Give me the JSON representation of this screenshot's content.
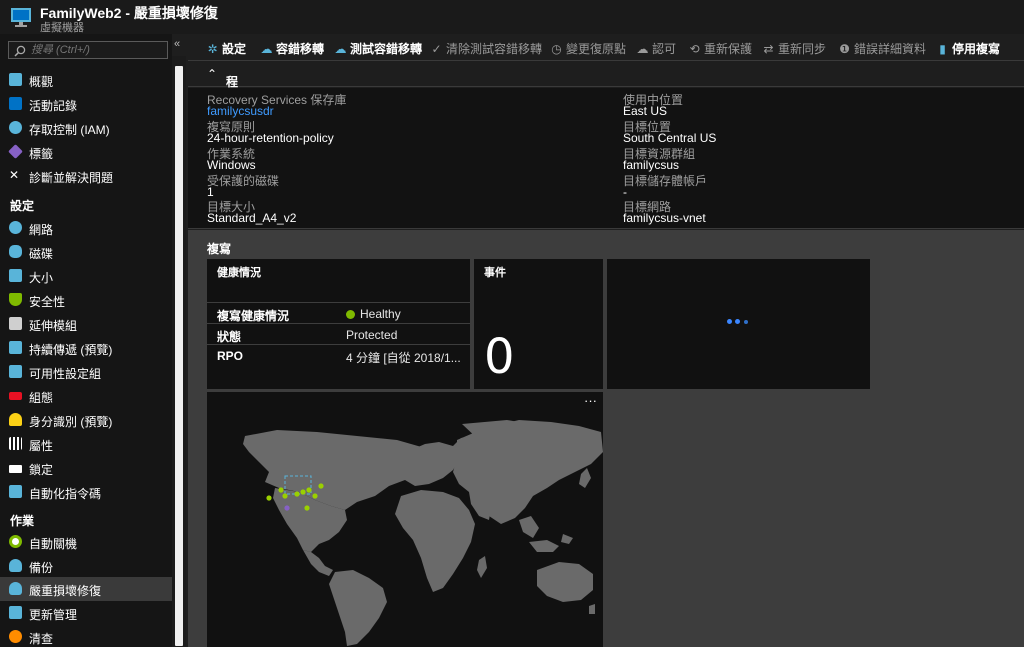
{
  "window": {
    "title": "FamilyWeb2 - 嚴重損壞修復",
    "subtitle": "虛擬機器",
    "collapse_glyph": "«"
  },
  "search": {
    "placeholder": "搜尋 (Ctrl+/)"
  },
  "sidebar": {
    "items": [
      {
        "label": "概觀",
        "icon": "monitor-icon",
        "color": "#59b4d9"
      },
      {
        "label": "活動記錄",
        "icon": "log-icon",
        "color": "#0072c6"
      },
      {
        "label": "存取控制 (IAM)",
        "icon": "users-icon",
        "color": "#59b4d9"
      },
      {
        "label": "標籤",
        "icon": "tag-icon",
        "color": "#8661c5"
      },
      {
        "label": "診斷並解決問題",
        "icon": "wrench-icon",
        "color": "#ffffff"
      }
    ],
    "section_settings": "設定",
    "settings_items": [
      {
        "label": "網路",
        "icon": "network-icon",
        "color": "#59b4d9"
      },
      {
        "label": "磁碟",
        "icon": "disk-icon",
        "color": "#59b4d9"
      },
      {
        "label": "大小",
        "icon": "monitor-icon",
        "color": "#59b4d9"
      },
      {
        "label": "安全性",
        "icon": "shield-icon",
        "color": "#7fba00"
      },
      {
        "label": "延伸模組",
        "icon": "extensions-icon",
        "color": "#ffffff"
      },
      {
        "label": "持續傳遞 (預覽)",
        "icon": "delivery-icon",
        "color": "#59b4d9"
      },
      {
        "label": "可用性設定組",
        "icon": "monitor-icon",
        "color": "#59b4d9"
      },
      {
        "label": "組態",
        "icon": "config-icon",
        "color": "#e81123"
      },
      {
        "label": "身分識別 (預覽)",
        "icon": "key-icon",
        "color": "#fcd116"
      },
      {
        "label": "屬性",
        "icon": "properties-icon",
        "color": "#ffffff"
      },
      {
        "label": "鎖定",
        "icon": "lock-icon",
        "color": "#ffffff"
      },
      {
        "label": "自動化指令碼",
        "icon": "script-icon",
        "color": "#59b4d9"
      }
    ],
    "section_operations": "作業",
    "operations_items": [
      {
        "label": "自動關機",
        "icon": "clock-icon",
        "color": "#7fba00"
      },
      {
        "label": "備份",
        "icon": "backup-icon",
        "color": "#59b4d9"
      },
      {
        "label": "嚴重損壞修復",
        "icon": "disaster-recovery-icon",
        "color": "#59b4d9"
      },
      {
        "label": "更新管理",
        "icon": "update-icon",
        "color": "#59b4d9"
      },
      {
        "label": "清查",
        "icon": "inventory-icon",
        "color": "#ff8c00"
      }
    ]
  },
  "toolbar": {
    "settings": "設定",
    "failover": "容錯移轉",
    "test_failover": "測試容錯移轉",
    "cleanup_test": "清除測試容錯移轉",
    "change_recovery_point": "變更復原點",
    "commit": "認可",
    "reprotect": "重新保護",
    "resync": "重新同步",
    "error_details": "錯誤詳細資料",
    "disable_replication": "停用複寫"
  },
  "essentials": {
    "header": "程式集",
    "left": [
      {
        "key": "Recovery Services 保存庫",
        "value": "familycsusdr",
        "link": true
      },
      {
        "key": "複寫原則",
        "value": "24-hour-retention-policy"
      },
      {
        "key": "作業系統",
        "value": "Windows"
      },
      {
        "key": "受保護的磁碟",
        "value": "1"
      },
      {
        "key": "目標大小",
        "value": "Standard_A4_v2"
      }
    ],
    "right": [
      {
        "key": "使用中位置",
        "value": "East US"
      },
      {
        "key": "目標位置",
        "value": "South Central US"
      },
      {
        "key": "目標資源群組",
        "value": "familycsus"
      },
      {
        "key": "目標儲存體帳戶",
        "value": "-"
      },
      {
        "key": "目標網路",
        "value": "familycsus-vnet"
      }
    ]
  },
  "replication": {
    "section_title": "複寫",
    "health_tile": {
      "title": "健康情況",
      "rows": [
        {
          "key": "複寫健康情況",
          "value": "Healthy"
        },
        {
          "key": "狀態",
          "value": "Protected"
        },
        {
          "key": "RPO",
          "value": "4 分鐘 [自從 2018/1..."
        }
      ]
    },
    "events_tile": {
      "title": "事件",
      "count": "0"
    },
    "map_tile": {
      "more": "···"
    }
  },
  "colors": {
    "accent": "#0072c6",
    "healthy": "#7fba00",
    "link": "#3f9bff"
  }
}
